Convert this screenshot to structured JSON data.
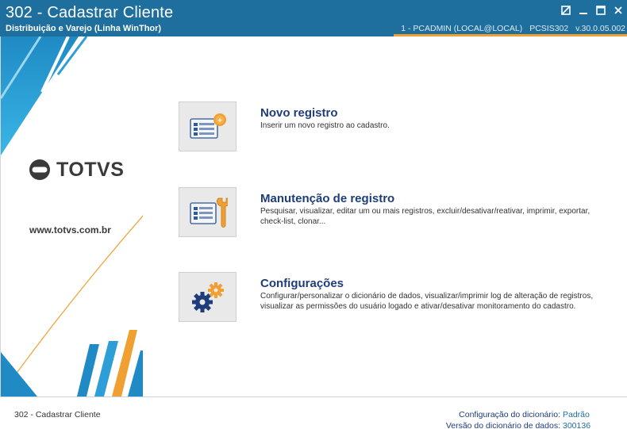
{
  "window": {
    "title": "302 - Cadastrar Cliente",
    "subtitle": "Distribuição e Varejo (Linha WinThor)",
    "connection": "1 - PCADMIN (LOCAL@LOCAL)",
    "routine": "PCSIS302",
    "version": "v.30.0.05.002"
  },
  "brand": {
    "logo_text": "TOTVS",
    "website": "www.totvs.com.br",
    "accent_orange": "#f0a030",
    "accent_blue": "#1e6f9e"
  },
  "options": [
    {
      "title": "Novo registro",
      "description": "Inserir um novo registro ao cadastro.",
      "icon": "new-record-icon"
    },
    {
      "title": "Manutenção de registro",
      "description": "Pesquisar, visualizar, editar um ou mais registros, excluir/desativar/reativar, imprimir, exportar, check-list,  clonar...",
      "icon": "maintenance-icon"
    },
    {
      "title": "Configurações",
      "description": "Configurar/personalizar o dicionário de dados, visualizar/imprimir log de alteração de registros, visualizar as permissões do usuário logado e ativar/desativar monitoramento do cadastro.",
      "icon": "gears-icon"
    }
  ],
  "status": {
    "routine_name": "302 - Cadastrar Cliente",
    "dict_config_label": "Configuração do dicionário:",
    "dict_config_value": "Padrão",
    "dict_version_label": "Versão do dicionário de dados:",
    "dict_version_value": "300136"
  }
}
